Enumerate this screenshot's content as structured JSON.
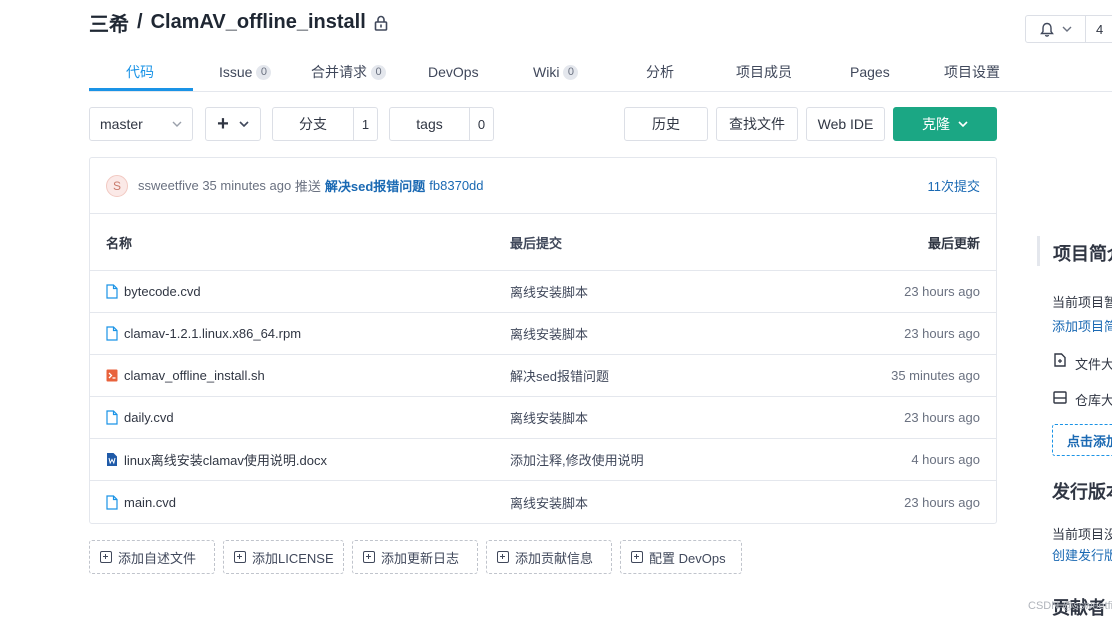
{
  "repo": {
    "owner": "三希",
    "separator": "/",
    "name": "ClamAV_offline_install"
  },
  "watch": {
    "count": "4"
  },
  "tabs": [
    {
      "label": "代码"
    },
    {
      "label": "Issue",
      "badge": "0"
    },
    {
      "label": "合并请求",
      "badge": "0"
    },
    {
      "label": "DevOps"
    },
    {
      "label": "Wiki",
      "badge": "0"
    },
    {
      "label": "分析"
    },
    {
      "label": "项目成员"
    },
    {
      "label": "Pages"
    },
    {
      "label": "项目设置"
    }
  ],
  "toolbar": {
    "branch": "master",
    "plus": "+",
    "branches_label": "分支",
    "branches_count": "1",
    "tags_label": "tags",
    "tags_count": "0",
    "history": "历史",
    "find_file": "查找文件",
    "web_ide": "Web IDE",
    "clone": "克隆"
  },
  "latest_commit": {
    "avatar_letter": "S",
    "author": "ssweetfive",
    "time": "35 minutes ago",
    "action": "推送",
    "message": "解决sed报错问题",
    "hash": "fb8370dd",
    "commit_count": "11次提交"
  },
  "table": {
    "headers": {
      "name": "名称",
      "last_commit": "最后提交",
      "last_update": "最后更新"
    },
    "rows": [
      {
        "name": "bytecode.cvd",
        "commit": "离线安装脚本",
        "time": "23 hours ago",
        "icon": "file-icon"
      },
      {
        "name": "clamav-1.2.1.linux.x86_64.rpm",
        "commit": "离线安装脚本",
        "time": "23 hours ago",
        "icon": "file-icon"
      },
      {
        "name": "clamav_offline_install.sh",
        "commit": "解决sed报错问题",
        "time": "35 minutes ago",
        "icon": "shell-script-icon"
      },
      {
        "name": "daily.cvd",
        "commit": "离线安装脚本",
        "time": "23 hours ago",
        "icon": "file-icon"
      },
      {
        "name": "linux离线安装clamav使用说明.docx",
        "commit": "添加注释,修改使用说明",
        "time": "4 hours ago",
        "icon": "word-doc-icon"
      },
      {
        "name": "main.cvd",
        "commit": "离线安装脚本",
        "time": "23 hours ago",
        "icon": "file-icon"
      }
    ]
  },
  "add_buttons": [
    {
      "label": "添加自述文件"
    },
    {
      "label": "添加LICENSE"
    },
    {
      "label": "添加更新日志"
    },
    {
      "label": "添加贡献信息"
    },
    {
      "label": "配置 DevOps"
    }
  ],
  "sidebar": {
    "intro_title": "项目简介",
    "intro_text": "当前项目暂",
    "intro_link": "添加项目简",
    "file_size": "文件大",
    "repo_size": "仓库大",
    "add_button": "点击添加",
    "release_title": "发行版本",
    "release_text": "当前项目没",
    "release_link": "创建发行版",
    "contributors_title": "贡献者"
  },
  "watermark": "CSDN @ssweetfive",
  "colors": {
    "accent": "#1a93e6",
    "clone": "#1ba784",
    "link": "#1a69b3"
  }
}
